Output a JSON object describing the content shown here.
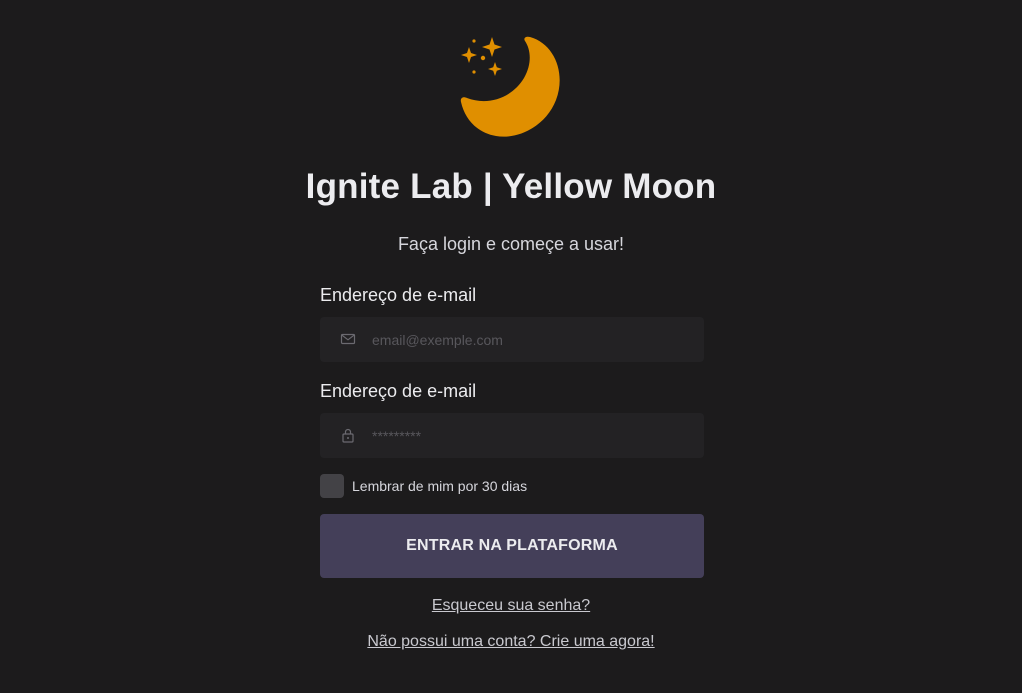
{
  "logo": {
    "icon": "moon-stars-icon",
    "color": "#e08f00"
  },
  "title": "Ignite Lab | Yellow Moon",
  "subtitle": "Faça login e começe a usar!",
  "form": {
    "email": {
      "label": "Endereço de e-mail",
      "placeholder": "email@exemple.com",
      "value": "",
      "icon": "envelope-icon"
    },
    "password": {
      "label": "Endereço de e-mail",
      "placeholder": "*********",
      "value": "",
      "icon": "lock-icon"
    },
    "remember": {
      "label": "Lembrar de mim por 30 dias",
      "checked": false
    },
    "submit_label": "ENTRAR NA PLATAFORMA"
  },
  "links": {
    "forgot_password": "Esqueceu sua senha?",
    "sign_up": "Não possui uma conta? Crie uma agora!"
  },
  "colors": {
    "background": "#1c1b1c",
    "accent": "#e08f00",
    "button": "#443f59",
    "input_bg": "#232224"
  }
}
